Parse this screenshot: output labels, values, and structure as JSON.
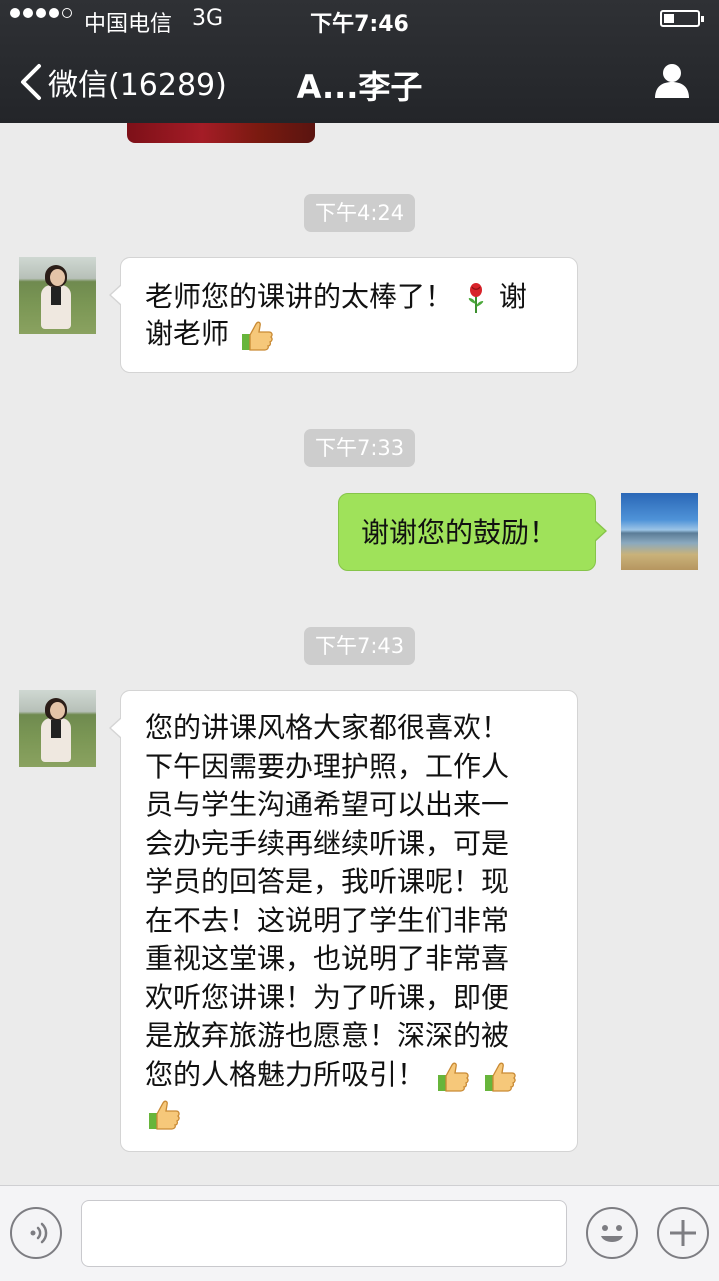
{
  "status_bar": {
    "carrier": "中国电信",
    "network": "3G",
    "time": "下午7:46",
    "battery_level": 0.3
  },
  "nav": {
    "back_label": "微信(16289)",
    "title": "A...李子",
    "back_icon": "chevron-left-icon",
    "profile_icon": "person-icon"
  },
  "messages": [
    {
      "type": "time",
      "text": "下午4:24"
    },
    {
      "type": "received",
      "text_line1": "老师您的课讲的太棒了！",
      "text_line1b": "谢",
      "text_line2": "谢老师"
    },
    {
      "type": "time",
      "text": "下午7:33"
    },
    {
      "type": "sent",
      "text": "谢谢您的鼓励！"
    },
    {
      "type": "time",
      "text": "下午7:43"
    },
    {
      "type": "received",
      "lines": [
        "您的讲课风格大家都很喜欢！",
        "下午因需要办理护照，工作人",
        "员与学生沟通希望可以出来一",
        "会办完手续再继续听课，可是",
        "学员的回答是，我听课呢！现",
        "在不去！这说明了学生们非常",
        "重视这堂课，也说明了非常喜",
        "欢听您讲课！为了听课，即便",
        "是放弃旅游也愿意！深深的被",
        "您的人格魅力所吸引！"
      ]
    }
  ],
  "input_bar": {
    "voice_icon": "voice-icon",
    "emoji_icon": "smiley-icon",
    "plus_icon": "plus-icon",
    "input_value": ""
  },
  "colors": {
    "header_bg": "#2a2c30",
    "chat_bg": "#ebebeb",
    "sent_bubble": "#9fe25a",
    "received_bubble": "#ffffff",
    "time_badge": "#cdcdcd"
  }
}
